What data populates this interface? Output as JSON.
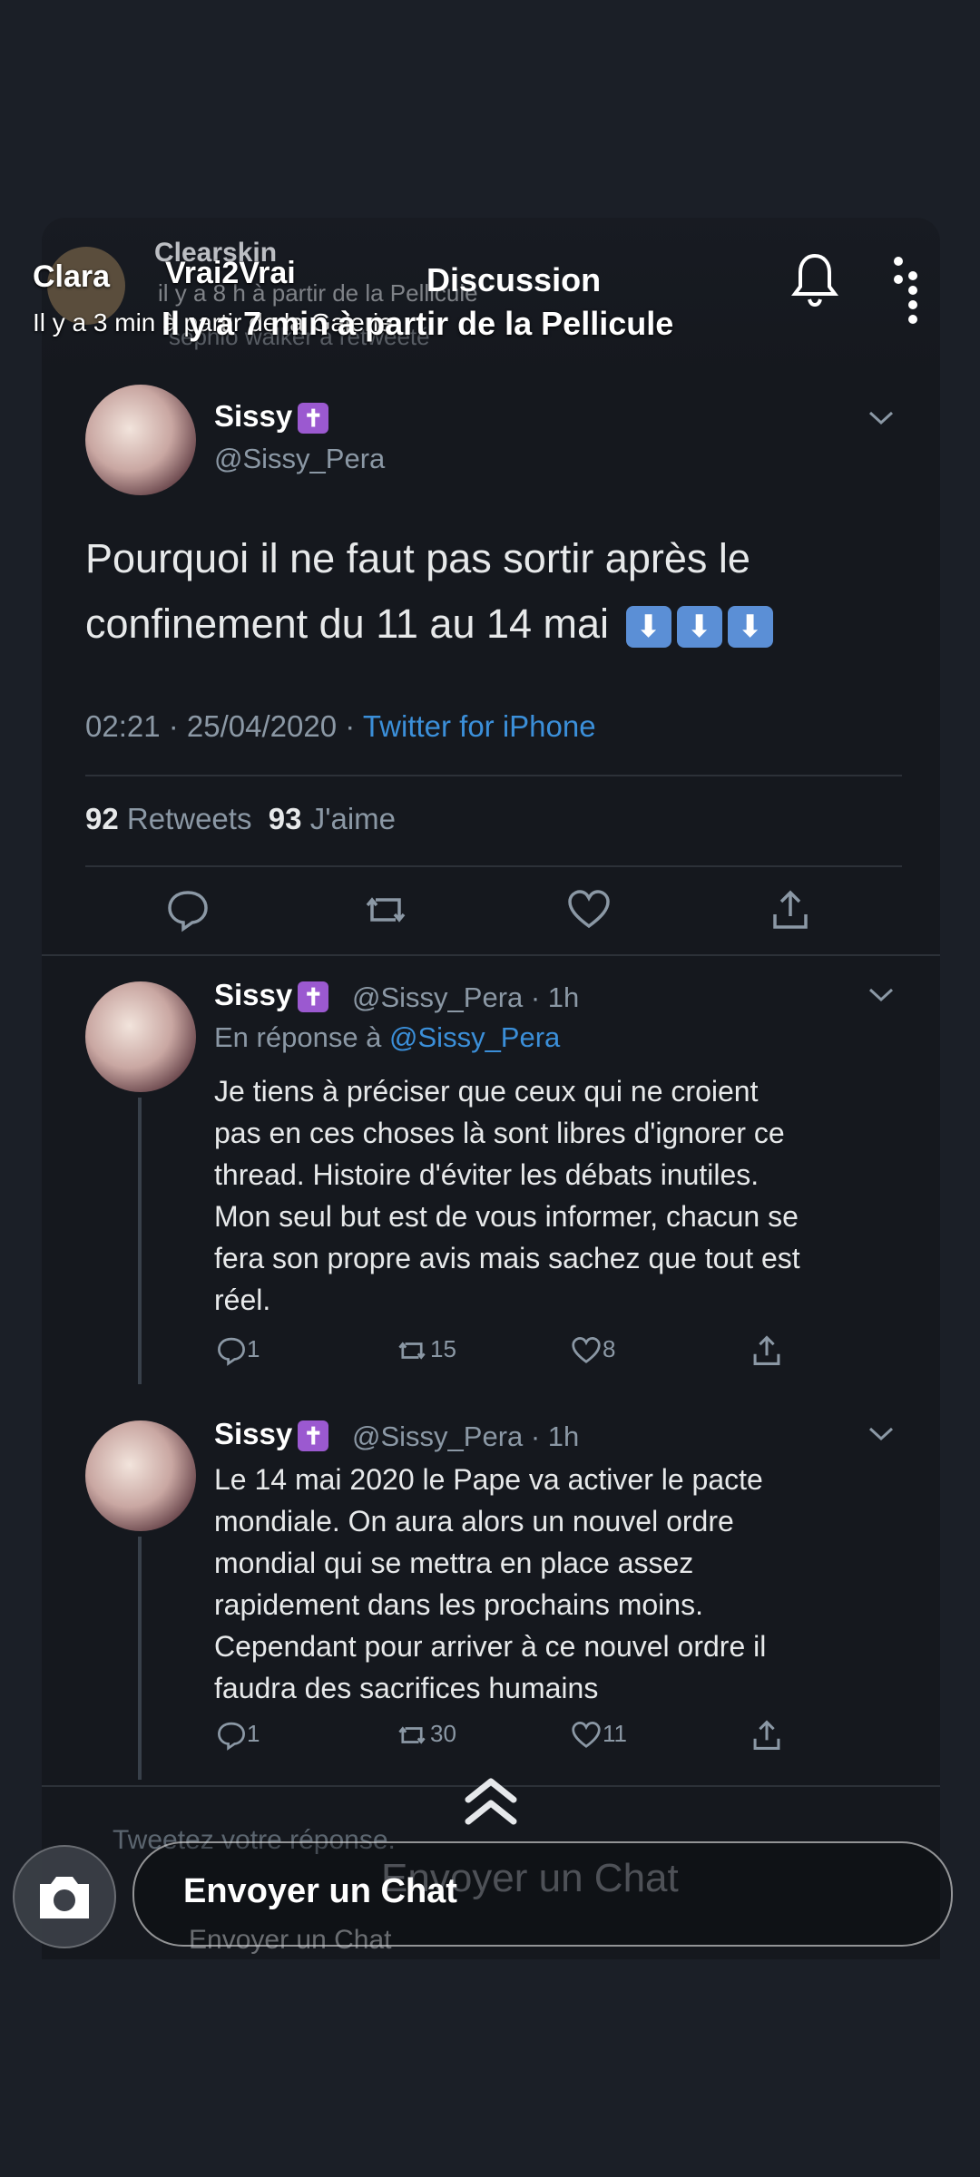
{
  "snapchat": {
    "sender_name": "Clara",
    "sender_time": "Il y a 3 min à partir de la Galerie",
    "story_name": "Vrai2Vrai",
    "story_sub": "Il y a 7 min à partir de la Pellicule",
    "ghost_account": "Clearskin",
    "ghost_sub": "il y a 8 h à partir de la Pellicule",
    "ghost_retweet": "sephio walker a retweeté",
    "reply_placeholder": "Tweetez votre réponse.",
    "chat_label": "Envoyer un Chat",
    "chat_ghost": "Envoyer un Chat",
    "chat_ghost2": "Envoyer un Chat"
  },
  "twitter": {
    "header_title": "Discussion",
    "main_tweet": {
      "name": "Sissy",
      "handle": "@Sissy_Pera",
      "text_line1": "Pourquoi il ne faut pas sortir après le",
      "text_line2": "confinement du 11 au 14 mai",
      "timestamp": "02:21 · 25/04/2020 · ",
      "source": "Twitter for iPhone",
      "retweets_count": "92",
      "retweets_label": "Retweets",
      "likes_count": "93",
      "likes_label": "J'aime"
    },
    "replies": [
      {
        "name": "Sissy",
        "handle_time": "@Sissy_Pera · 1h",
        "reply_to_prefix": "En réponse à ",
        "reply_to": "@Sissy_Pera",
        "lines": [
          "Je tiens à préciser que ceux qui ne croient",
          "pas en ces choses là sont libres d'ignorer ce",
          "thread. Histoire d'éviter les débats inutiles.",
          "Mon seul but est de vous informer, chacun se",
          "fera son propre avis mais sachez que tout est",
          "réel."
        ],
        "replies": "1",
        "retweets": "15",
        "likes": "8"
      },
      {
        "name": "Sissy",
        "handle_time": "@Sissy_Pera · 1h",
        "lines": [
          "Le 14 mai 2020 le Pape va activer le pacte",
          "mondiale. On aura alors un nouvel ordre",
          "mondial qui se mettra en place assez",
          "rapidement dans les prochains moins.",
          "Cependant pour arriver à ce nouvel ordre il",
          "faudra des sacrifices humains"
        ],
        "replies": "1",
        "retweets": "30",
        "likes": "11"
      }
    ]
  },
  "colors": {
    "background": "#1b1f27",
    "tweet_bg": "#15181e",
    "link": "#3b8fd9",
    "muted": "#8b98a5",
    "cross_badge": "#9b59d0",
    "arrow_emoji": "#5b8fd6"
  },
  "icons": [
    "bell-icon",
    "more-dots-icon",
    "chevron-down-icon",
    "reply-icon",
    "retweet-icon",
    "like-icon",
    "share-icon",
    "camera-icon",
    "swipe-up-icon",
    "arrow-down-emoji"
  ]
}
